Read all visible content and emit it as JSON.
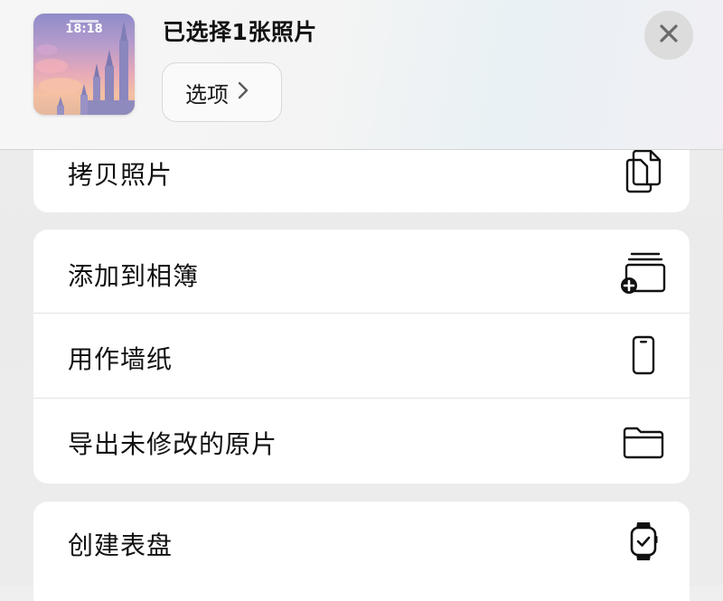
{
  "header": {
    "title": "已选择1张照片",
    "options_label": "选项",
    "thumbnail": {
      "time": "18:18"
    }
  },
  "actions": {
    "copy": {
      "label": "拷贝照片",
      "icon": "copy-icon"
    },
    "add_to_album": {
      "label": "添加到相簿",
      "icon": "add-to-album-icon"
    },
    "use_as_wallpaper": {
      "label": "用作墙纸",
      "icon": "iphone-icon"
    },
    "export_unmodified": {
      "label": "导出未修改的原片",
      "icon": "folder-icon"
    },
    "create_watch_face": {
      "label": "创建表盘",
      "icon": "watch-icon"
    }
  },
  "icons": {
    "close": "close-icon",
    "options_chevron": "chevron-right-icon"
  },
  "colors": {
    "sheet_background": "#ededed",
    "group_background": "#ffffff",
    "close_button_bg": "#dcdcdc",
    "divider": "#e4e4e4"
  }
}
